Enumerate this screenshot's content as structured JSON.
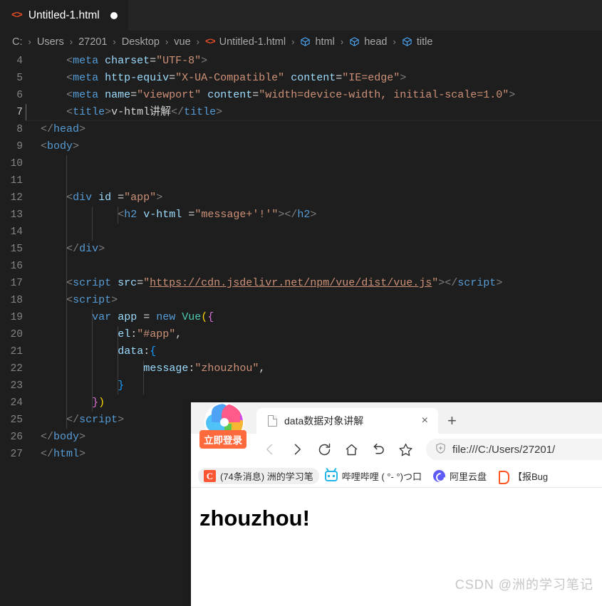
{
  "editor": {
    "tab": {
      "label": "Untitled-1.html",
      "icon": "html5-icon",
      "dirty_indicator": "unsaved-dot"
    },
    "breadcrumb": [
      {
        "label": "C:",
        "icon": ""
      },
      {
        "label": "Users",
        "icon": ""
      },
      {
        "label": "27201",
        "icon": ""
      },
      {
        "label": "Desktop",
        "icon": ""
      },
      {
        "label": "vue",
        "icon": ""
      },
      {
        "label": "Untitled-1.html",
        "icon": "html5-icon"
      },
      {
        "label": "html",
        "icon": "symbol-tag-icon"
      },
      {
        "label": "head",
        "icon": "symbol-tag-icon"
      },
      {
        "label": "title",
        "icon": "symbol-tag-icon"
      }
    ],
    "separator": "›",
    "active_line": 7,
    "lines": [
      {
        "n": "4",
        "html": "<span class='t-bracket'>&lt;</span><span class='t-tag'>meta</span> <span class='t-attr'>charset</span><span class='t-eq'>=</span><span class='t-str'>\"UTF-8\"</span><span class='t-bracket'>&gt;</span>",
        "indent": 4
      },
      {
        "n": "5",
        "html": "<span class='t-bracket'>&lt;</span><span class='t-tag'>meta</span> <span class='t-attr'>http-equiv</span><span class='t-eq'>=</span><span class='t-str'>\"X-UA-Compatible\"</span> <span class='t-attr'>content</span><span class='t-eq'>=</span><span class='t-str'>\"IE=edge\"</span><span class='t-bracket'>&gt;</span>",
        "indent": 4
      },
      {
        "n": "6",
        "html": "<span class='t-bracket'>&lt;</span><span class='t-tag'>meta</span> <span class='t-attr'>name</span><span class='t-eq'>=</span><span class='t-str'>\"viewport\"</span> <span class='t-attr'>content</span><span class='t-eq'>=</span><span class='t-str'>\"width=device-width, initial-scale=1.0\"</span><span class='t-bracket'>&gt;</span>",
        "indent": 4
      },
      {
        "n": "7",
        "html": "<span class='t-bracket'>&lt;</span><span class='t-tag'>title</span><span class='t-bracket'>&gt;</span><span class='t-plain'>v-html讲解</span><span class='t-bracket'>&lt;/</span><span class='t-tag'>title</span><span class='t-bracket'>&gt;</span>",
        "indent": 4
      },
      {
        "n": "8",
        "html": "<span class='t-bracket'>&lt;/</span><span class='t-tag'>head</span><span class='t-bracket'>&gt;</span>",
        "indent": 0
      },
      {
        "n": "9",
        "html": "<span class='t-bracket'>&lt;</span><span class='t-tag'>body</span><span class='t-bracket'>&gt;</span>",
        "indent": 0
      },
      {
        "n": "10",
        "html": "",
        "indent": 0
      },
      {
        "n": "11",
        "html": "",
        "indent": 0
      },
      {
        "n": "12",
        "html": "<span class='t-bracket'>&lt;</span><span class='t-tag'>div</span> <span class='t-attr'>id</span> <span class='t-eq'>=</span><span class='t-str'>\"app\"</span><span class='t-bracket'>&gt;</span>",
        "indent": 4
      },
      {
        "n": "13",
        "html": "<span class='t-bracket'>&lt;</span><span class='t-tag'>h2</span> <span class='t-attr'>v-html</span> <span class='t-eq'>=</span><span class='t-str'>\"message+'!'\"</span><span class='t-bracket'>&gt;</span><span class='t-bracket'>&lt;/</span><span class='t-tag'>h2</span><span class='t-bracket'>&gt;</span>",
        "indent": 12
      },
      {
        "n": "14",
        "html": "",
        "indent": 0
      },
      {
        "n": "15",
        "html": "<span class='t-bracket'>&lt;/</span><span class='t-tag'>div</span><span class='t-bracket'>&gt;</span>",
        "indent": 4
      },
      {
        "n": "16",
        "html": "",
        "indent": 0
      },
      {
        "n": "17",
        "html": "<span class='t-bracket'>&lt;</span><span class='t-tag'>script</span> <span class='t-attr'>src</span><span class='t-eq'>=</span><span class='t-str'>\"</span><span class='t-link'>https://cdn.jsdelivr.net/npm/vue/dist/vue.js</span><span class='t-str'>\"</span><span class='t-bracket'>&gt;</span><span class='t-bracket'>&lt;/</span><span class='t-tag'>script</span><span class='t-bracket'>&gt;</span>",
        "indent": 4
      },
      {
        "n": "18",
        "html": "<span class='t-bracket'>&lt;</span><span class='t-tag'>script</span><span class='t-bracket'>&gt;</span>",
        "indent": 4
      },
      {
        "n": "19",
        "html": "<span class='t-kw'>var</span> <span class='t-var'>app</span> <span class='t-punc'>=</span> <span class='t-new'>new</span> <span class='t-cls'>Vue</span><span class='t-brace1'>(</span><span class='t-brace2'>{</span>",
        "indent": 8
      },
      {
        "n": "20",
        "html": "<span class='t-prop'>el</span><span class='t-punc'>:</span><span class='t-str'>\"#app\"</span><span class='t-punc'>,</span>",
        "indent": 12
      },
      {
        "n": "21",
        "html": "<span class='t-prop'>data</span><span class='t-punc'>:</span><span class='t-brace3'>{</span>",
        "indent": 12
      },
      {
        "n": "22",
        "html": "<span class='t-prop'>message</span><span class='t-punc'>:</span><span class='t-str'>\"zhouzhou\"</span><span class='t-punc'>,</span>",
        "indent": 16
      },
      {
        "n": "23",
        "html": "<span class='t-brace3'>}</span>",
        "indent": 12
      },
      {
        "n": "24",
        "html": "<span class='t-brace2'>}</span><span class='t-brace1'>)</span>",
        "indent": 8
      },
      {
        "n": "25",
        "html": "<span class='t-bracket'>&lt;/</span><span class='t-tag'>script</span><span class='t-bracket'>&gt;</span>",
        "indent": 4
      },
      {
        "n": "26",
        "html": "<span class='t-bracket'>&lt;/</span><span class='t-tag'>body</span><span class='t-bracket'>&gt;</span>",
        "indent": 0
      },
      {
        "n": "27",
        "html": "<span class='t-bracket'>&lt;/</span><span class='t-tag'>html</span><span class='t-bracket'>&gt;</span>",
        "indent": 0
      }
    ]
  },
  "browser": {
    "login_button": "立即登录",
    "logo": "360-pinwheel-logo",
    "tab": {
      "title": "data数据对象讲解",
      "close": "×"
    },
    "new_tab": "+",
    "toolbar": {
      "back": "back-arrow-icon",
      "forward": "forward-arrow-icon",
      "reload": "reload-icon",
      "home": "home-icon",
      "undo": "undo-icon",
      "bookmark": "star-icon"
    },
    "url": "file:///C:/Users/27201/",
    "bookmarks": [
      {
        "label": "(74条消息) 洲的学习笔",
        "icon": "csdn-icon",
        "highlighted": true
      },
      {
        "label": "哔哩哔哩 ( °- °)つ口",
        "icon": "bilibili-icon",
        "highlighted": false
      },
      {
        "label": "阿里云盘",
        "icon": "aliyun-icon",
        "highlighted": false
      },
      {
        "label": "【报Bug",
        "icon": "bug-icon",
        "highlighted": false
      }
    ],
    "page": {
      "heading": "zhouzhou!"
    }
  },
  "watermark": "CSDN @洲的学习笔记",
  "colors": {
    "editor_bg": "#1e1e1e",
    "tabbar_bg": "#252526",
    "accent_html": "#e44d26",
    "accent_tag": "#519aba",
    "browser_accent": "#ff6a3d",
    "csdn_red": "#fc5531",
    "bilibili_blue": "#25b6e8",
    "aliyun_purple": "#5f5bf5"
  }
}
